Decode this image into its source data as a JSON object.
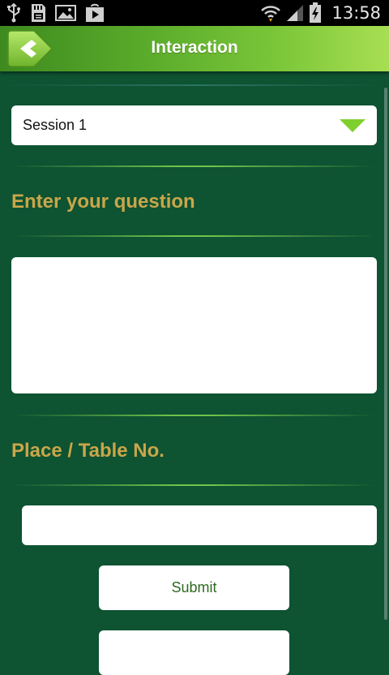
{
  "status_bar": {
    "time": "13:58",
    "left_icons": [
      "usb-icon",
      "sd-card-icon",
      "gallery-icon",
      "play-store-icon"
    ],
    "right_icons": [
      "wifi-icon",
      "signal-icon",
      "battery-charging-icon"
    ]
  },
  "header": {
    "title": "Interaction",
    "back_icon": "back-arrow-icon",
    "gradient_colors": [
      "#3e8a1f",
      "#a8de52"
    ]
  },
  "session_select": {
    "selected": "Session 1",
    "arrow_color": "#7fcf2e"
  },
  "question_section": {
    "label": "Enter your question",
    "value": "",
    "placeholder": ""
  },
  "table_section": {
    "label": "Place / Table No.",
    "value": "",
    "placeholder": ""
  },
  "buttons": {
    "submit_label": "Submit",
    "second_label": ""
  },
  "colors": {
    "background": "#0e5332",
    "label_gold": "#c9a64a",
    "button_text": "#2d6b1f",
    "divider": "#6fc44b"
  }
}
